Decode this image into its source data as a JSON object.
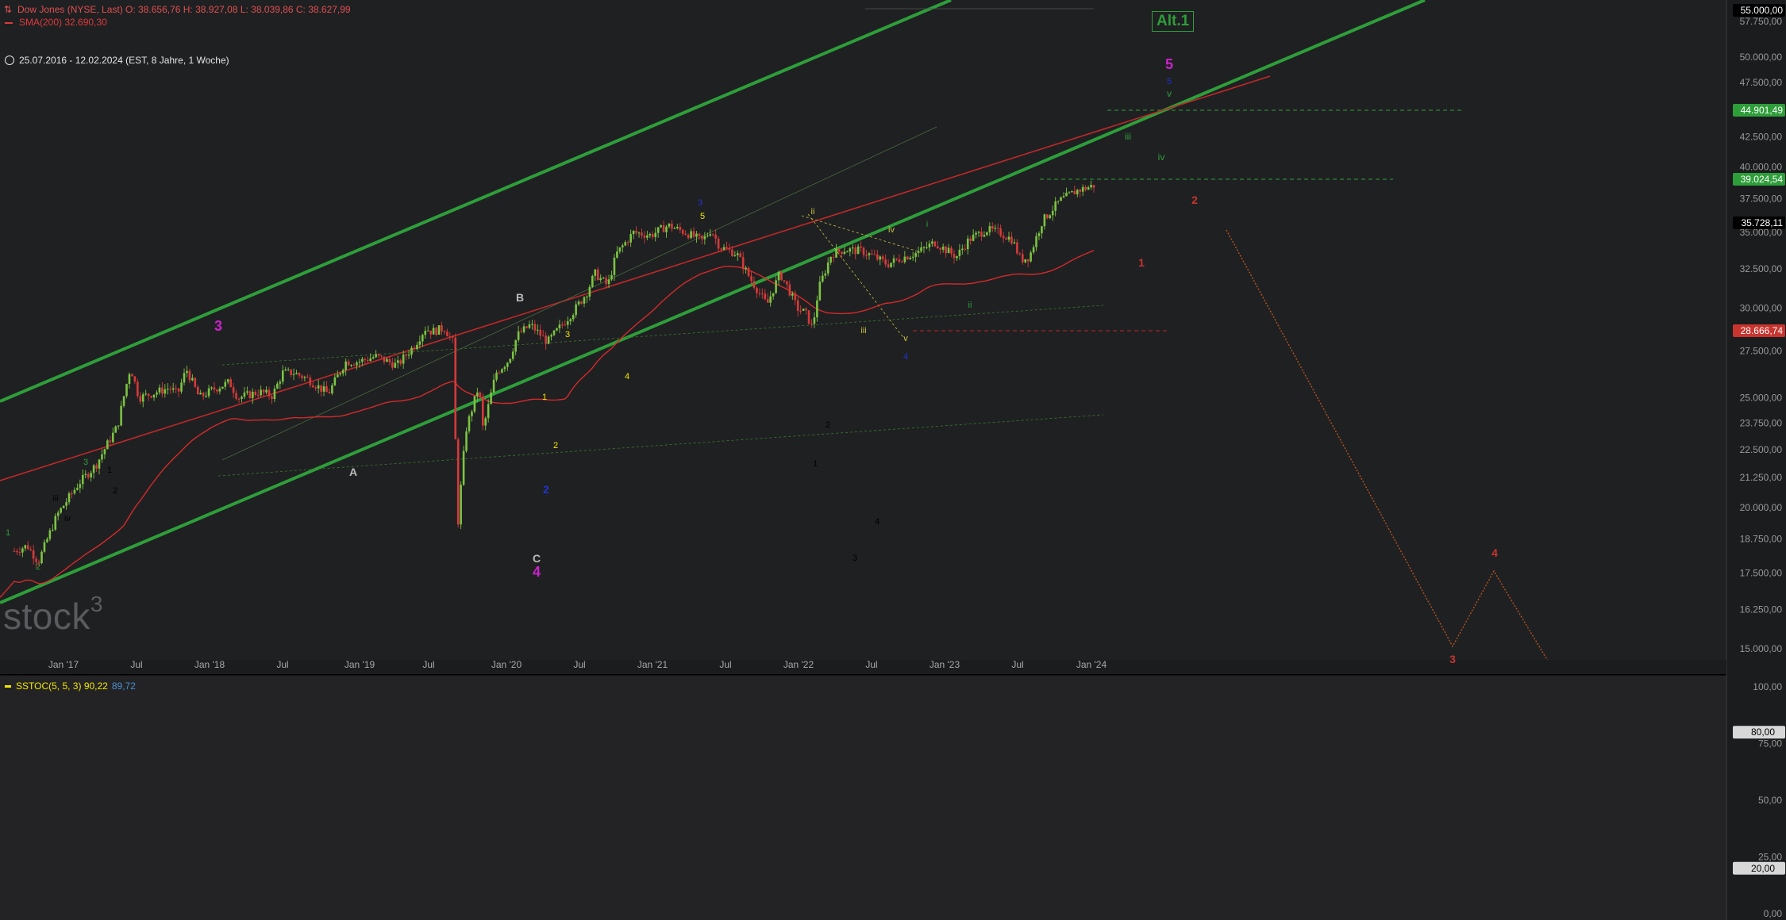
{
  "header": {
    "main_icon": "chart-icon",
    "main_info": "Dow Jones (NYSE, Last)  O: 38.656,76  H: 38.927,08  L: 38.039,86  C: 38.627,99",
    "sma_info": "SMA(200)  32.690,30",
    "range_info": "25.07.2016 - 12.02.2024   (EST, 8 Jahre, 1 Woche)"
  },
  "logo": {
    "text": "stock",
    "sup": "3"
  },
  "alt_label": "Alt.1",
  "colors": {
    "background": "#1f2022",
    "up_candle": "#7cc443",
    "down_candle": "#d63a3a",
    "sma": "#d42a2a",
    "channel_green": "#2e9e3a",
    "stoch_k": "#f2e600",
    "stoch_d": "#3f86c8",
    "badge_green": "#2e9e3a",
    "badge_red": "#c8342e"
  },
  "price_axis": {
    "ticks": [
      "57.750,00",
      "50.000,00",
      "47.500,00",
      "42.500,00",
      "40.000,00",
      "37.500,00",
      "35.000,00",
      "32.500,00",
      "30.000,00",
      "27.500,00",
      "25.000,00",
      "23.750,00",
      "22.500,00",
      "21.250,00",
      "20.000,00",
      "18.750,00",
      "17.500,00",
      "16.250,00",
      "15.000,00"
    ],
    "badges": [
      {
        "label": "55.000,00",
        "style": "black"
      },
      {
        "label": "44.901,49",
        "style": "green"
      },
      {
        "label": "39.024,54",
        "style": "green"
      },
      {
        "label": "35.728,11",
        "style": "black"
      },
      {
        "label": "28.666,74",
        "style": "red"
      }
    ]
  },
  "time_axis": [
    "Jan '17",
    "Jul",
    "Jan '18",
    "Jul",
    "Jan '19",
    "Jul",
    "Jan '20",
    "Jul",
    "Jan '21",
    "Jul",
    "Jan '22",
    "Jul",
    "Jan '23",
    "Jul",
    "Jan '24"
  ],
  "indicator": {
    "name": "SSTOC(5, 5, 3)",
    "k_value": "90,22",
    "d_value": "89,72",
    "axis_ticks": [
      "100,00",
      "75,00",
      "50,00",
      "25,00",
      "0,00"
    ],
    "badges": [
      "80,00",
      "20,00"
    ]
  },
  "wave_labels": [
    {
      "text": "1",
      "color": "#2e9e3a"
    },
    {
      "text": "2",
      "color": "#2e9e3a"
    },
    {
      "text": "3",
      "color": "#2e9e3a"
    },
    {
      "text": "1",
      "color": "#000000"
    },
    {
      "text": "2",
      "color": "#000000"
    },
    {
      "text": "iii",
      "color": "#000000"
    },
    {
      "text": "iv",
      "color": "#000000"
    },
    {
      "text": "3",
      "color": "#cc22cc"
    },
    {
      "text": "4",
      "color": "#cc22cc"
    },
    {
      "text": "5",
      "color": "#cc22cc"
    },
    {
      "text": "A",
      "color": "#bbbbbb"
    },
    {
      "text": "B",
      "color": "#bbbbbb"
    },
    {
      "text": "C",
      "color": "#bbbbbb"
    },
    {
      "text": "1",
      "color": "#f2e600"
    },
    {
      "text": "2",
      "color": "#f2e600"
    },
    {
      "text": "3",
      "color": "#f2e600"
    },
    {
      "text": "4",
      "color": "#f2e600"
    },
    {
      "text": "5",
      "color": "#f2e600"
    },
    {
      "text": "2",
      "color": "#2233cc"
    },
    {
      "text": "3",
      "color": "#2233cc"
    },
    {
      "text": "4",
      "color": "#2233cc"
    },
    {
      "text": "5",
      "color": "#2233cc"
    },
    {
      "text": "i",
      "color": "#2e9e3a"
    },
    {
      "text": "ii",
      "color": "#2e9e3a"
    },
    {
      "text": "iii",
      "color": "#2e9e3a"
    },
    {
      "text": "iv",
      "color": "#2e9e3a"
    },
    {
      "text": "v",
      "color": "#2e9e3a"
    },
    {
      "text": "ii",
      "color": "#c8c040"
    },
    {
      "text": "iii",
      "color": "#c8c040"
    },
    {
      "text": "iv",
      "color": "#c8c040"
    },
    {
      "text": "v",
      "color": "#c8c040"
    },
    {
      "text": "1",
      "color": "#c8342e"
    },
    {
      "text": "2",
      "color": "#c8342e"
    },
    {
      "text": "3",
      "color": "#c8342e"
    },
    {
      "text": "4",
      "color": "#c8342e"
    },
    {
      "text": "1",
      "color": "#000000"
    },
    {
      "text": "2",
      "color": "#000000"
    },
    {
      "text": "3",
      "color": "#000000"
    },
    {
      "text": "4",
      "color": "#000000"
    }
  ]
}
